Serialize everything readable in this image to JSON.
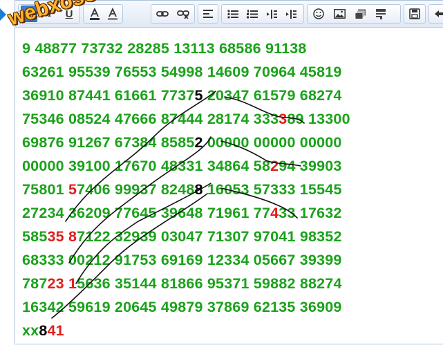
{
  "watermark": "webxoso.net",
  "toolbar": {
    "bold_label": "B",
    "italic_label": "I",
    "underline_label": "U",
    "buttons": [
      "bold-button",
      "italic-button",
      "underline-button",
      "font-color-button",
      "background-color-button",
      "link-button",
      "unlink-button",
      "align-left-button",
      "bulleted-list-button",
      "numbered-list-button",
      "outdent-button",
      "indent-button",
      "emoji-button",
      "image-button",
      "table-button",
      "more-button",
      "save-button",
      "undo-button"
    ]
  },
  "lines": [
    [
      {
        "t": "9 "
      },
      {
        "t": "48877 73732 28285 13113 68586 91138"
      }
    ],
    [
      {
        "t": "63261 95539 76553 54998 14609 70964 45819"
      }
    ],
    [
      {
        "t": "36910 87441 61661 7737"
      },
      {
        "t": "5",
        "c": "black"
      },
      {
        "t": " 20347 61579 68274"
      }
    ],
    [
      {
        "t": "75346 08524 47666 87444 28174 333"
      },
      {
        "t": "3",
        "c": "red"
      },
      {
        "t": "89 13300"
      }
    ],
    [
      {
        "t": "69876 91267 67384 8585"
      },
      {
        "t": "2",
        "c": "black"
      },
      {
        "t": " 00000 00000 00000"
      }
    ],
    [
      {
        "t": "00000 39100 17670 48331 34864 58"
      },
      {
        "t": "2",
        "c": "red"
      },
      {
        "t": "94 39903"
      }
    ],
    [
      {
        "t": "75801 "
      },
      {
        "t": "5",
        "c": "red"
      },
      {
        "t": "7406 99937 8248"
      },
      {
        "t": "8",
        "c": "black"
      },
      {
        "t": " 16053 57333 15545"
      }
    ],
    [
      {
        "t": "27234 36209 77645 39648 71961 77"
      },
      {
        "t": "4",
        "c": "red"
      },
      {
        "t": "33 17632"
      }
    ],
    [
      {
        "t": "585"
      },
      {
        "t": "35",
        "c": "red"
      },
      {
        "t": " "
      },
      {
        "t": "8",
        "c": "red"
      },
      {
        "t": "7122 32939 03047 71307 97041 98352"
      }
    ],
    [
      {
        "t": "68333 00212 91753 69169 12334 05667 39399"
      }
    ],
    [
      {
        "t": "787"
      },
      {
        "t": "23",
        "c": "red"
      },
      {
        "t": " "
      },
      {
        "t": "1",
        "c": "red"
      },
      {
        "t": "5636 35144 81866 95371 59882 88274"
      }
    ],
    [
      {
        "t": "16342 59619 20645 49879 37869 62135 36909"
      }
    ],
    [
      {
        "t": "xx"
      },
      {
        "t": "8",
        "c": "black"
      },
      {
        "t": "41",
        "c": "red"
      }
    ]
  ]
}
